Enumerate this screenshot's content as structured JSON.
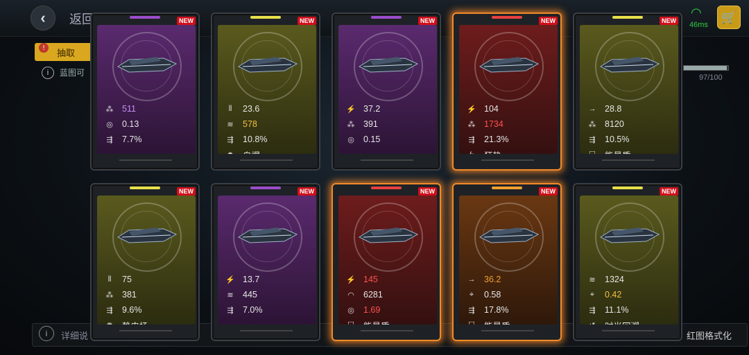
{
  "header": {
    "back_label": "返回",
    "ping": "46ms"
  },
  "toolbar": {
    "tab_label": "抽取"
  },
  "info_text": "蓝图可",
  "progress": {
    "value": 97,
    "max": 100,
    "text": "97/100"
  },
  "footer": {
    "detail_text": "详细说",
    "format_text": "红图格式化"
  },
  "colors": {
    "purple": "#9b4dca",
    "yellow": "#e8e04a",
    "red": "#e84040",
    "orange": "#f0a030",
    "new_badge": "#d10f1a"
  },
  "cards": [
    {
      "rarity": "purple",
      "new": "NEW",
      "glow": false,
      "stats": [
        {
          "icon": "cluster-icon",
          "value": "511",
          "color": "#c58cf0"
        },
        {
          "icon": "ring-icon",
          "value": "0.13",
          "color": "#e6e6e6"
        },
        {
          "icon": "crit-icon",
          "value": "7.7%",
          "color": "#e6e6e6"
        }
      ]
    },
    {
      "rarity": "yellow",
      "new": "NEW",
      "glow": false,
      "stats": [
        {
          "icon": "ammo-icon",
          "value": "23.6",
          "color": "#e6e6e6"
        },
        {
          "icon": "range-icon",
          "value": "578",
          "color": "#f0c040"
        },
        {
          "icon": "crit-icon",
          "value": "10.8%",
          "color": "#e6e6e6"
        },
        {
          "icon": "explode-icon",
          "value": "自爆",
          "color": "#e6e6e6"
        }
      ]
    },
    {
      "rarity": "purple",
      "new": "NEW",
      "glow": false,
      "stats": [
        {
          "icon": "damage-icon",
          "value": "37.2",
          "color": "#e6e6e6"
        },
        {
          "icon": "cluster-icon",
          "value": "391",
          "color": "#e6e6e6"
        },
        {
          "icon": "ring-icon",
          "value": "0.15",
          "color": "#e6e6e6"
        }
      ]
    },
    {
      "rarity": "red",
      "new": "NEW",
      "glow": true,
      "stats": [
        {
          "icon": "damage-icon",
          "value": "104",
          "color": "#e6e6e6"
        },
        {
          "icon": "cluster-icon",
          "value": "1734",
          "color": "#ff5050"
        },
        {
          "icon": "crit-icon",
          "value": "21.3%",
          "color": "#e6e6e6"
        },
        {
          "icon": "frenzy-icon",
          "value": "狂热",
          "color": "#e6e6e6"
        }
      ]
    },
    {
      "rarity": "yellow",
      "new": "NEW",
      "glow": false,
      "stats": [
        {
          "icon": "speed-icon",
          "value": "28.8",
          "color": "#e6e6e6"
        },
        {
          "icon": "cluster-icon",
          "value": "8120",
          "color": "#e6e6e6"
        },
        {
          "icon": "crit-icon",
          "value": "10.5%",
          "color": "#e6e6e6"
        },
        {
          "icon": "shield-icon",
          "value": "能量盾",
          "color": "#e6e6e6"
        }
      ]
    },
    {
      "rarity": "yellow",
      "new": "NEW",
      "glow": false,
      "stats": [
        {
          "icon": "ammo-icon",
          "value": "75",
          "color": "#e6e6e6"
        },
        {
          "icon": "cluster-icon",
          "value": "381",
          "color": "#e6e6e6"
        },
        {
          "icon": "crit-icon",
          "value": "9.6%",
          "color": "#e6e6e6"
        },
        {
          "icon": "static-icon",
          "value": "静电场",
          "color": "#e6e6e6"
        }
      ]
    },
    {
      "rarity": "purple",
      "new": "NEW",
      "glow": false,
      "stats": [
        {
          "icon": "damage-icon",
          "value": "13.7",
          "color": "#e6e6e6"
        },
        {
          "icon": "range-icon",
          "value": "445",
          "color": "#e6e6e6"
        },
        {
          "icon": "crit-icon",
          "value": "7.0%",
          "color": "#e6e6e6"
        }
      ]
    },
    {
      "rarity": "red",
      "new": "NEW",
      "glow": true,
      "stats": [
        {
          "icon": "damage-icon",
          "value": "145",
          "color": "#ff5050"
        },
        {
          "icon": "armor-icon",
          "value": "6281",
          "color": "#e6e6e6"
        },
        {
          "icon": "ring-icon",
          "value": "1.69",
          "color": "#ff5050"
        },
        {
          "icon": "shield-icon",
          "value": "能量盾",
          "color": "#e6e6e6"
        }
      ]
    },
    {
      "rarity": "orange",
      "new": "NEW",
      "glow": true,
      "stats": [
        {
          "icon": "speed-icon",
          "value": "36.2",
          "color": "#f0a030"
        },
        {
          "icon": "target-icon",
          "value": "0.58",
          "color": "#e6e6e6"
        },
        {
          "icon": "crit-icon",
          "value": "17.8%",
          "color": "#e6e6e6"
        },
        {
          "icon": "shield-icon",
          "value": "能量盾",
          "color": "#e6e6e6"
        }
      ]
    },
    {
      "rarity": "yellow",
      "new": "NEW",
      "glow": false,
      "stats": [
        {
          "icon": "range-icon",
          "value": "1324",
          "color": "#e6e6e6"
        },
        {
          "icon": "target-icon",
          "value": "0.42",
          "color": "#f0c040"
        },
        {
          "icon": "crit-icon",
          "value": "11.1%",
          "color": "#e6e6e6"
        },
        {
          "icon": "rewind-icon",
          "value": "时光回溯",
          "color": "#e6e6e6"
        }
      ]
    }
  ]
}
